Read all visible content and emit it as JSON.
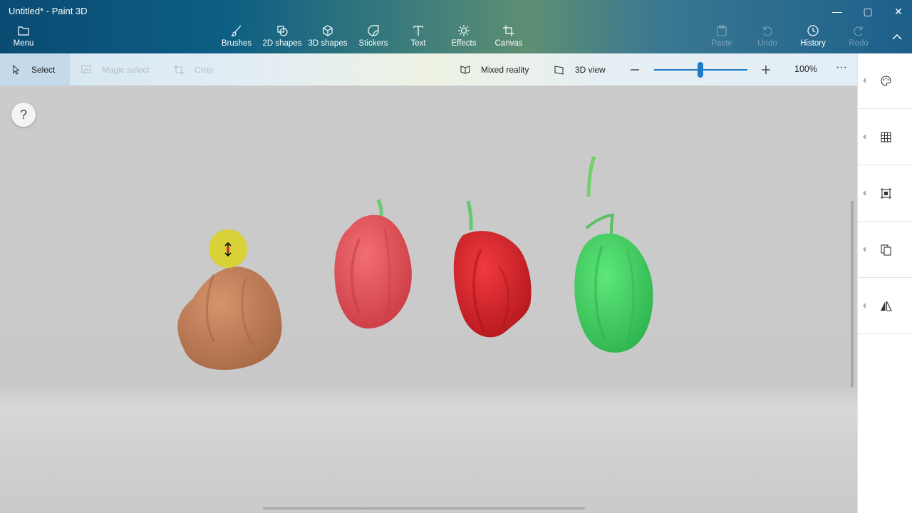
{
  "window": {
    "title": "Untitled* - Paint 3D",
    "minimize": "—",
    "maximize": "▢",
    "close": "✕"
  },
  "ribbon": {
    "menu": "Menu",
    "tools": [
      {
        "label": "Brushes",
        "icon": "brush-icon"
      },
      {
        "label": "2D shapes",
        "icon": "2d-shapes-icon"
      },
      {
        "label": "3D shapes",
        "icon": "3d-shapes-icon"
      },
      {
        "label": "Stickers",
        "icon": "stickers-icon"
      },
      {
        "label": "Text",
        "icon": "text-icon"
      },
      {
        "label": "Effects",
        "icon": "effects-icon"
      },
      {
        "label": "Canvas",
        "icon": "canvas-icon"
      }
    ],
    "actions": [
      {
        "label": "Paste",
        "enabled": false
      },
      {
        "label": "Undo",
        "enabled": false
      },
      {
        "label": "History",
        "enabled": true
      },
      {
        "label": "Redo",
        "enabled": false
      }
    ]
  },
  "toolbar": {
    "select": "Select",
    "magic_select": "Magic select",
    "crop": "Crop",
    "mixed_reality": "Mixed reality",
    "view_3d": "3D view",
    "zoom_minus": "—",
    "zoom_plus": "+",
    "zoom_level": "100%",
    "zoom_fraction": 0.5,
    "more": "···"
  },
  "canvas": {
    "help": "?",
    "objects": [
      {
        "name": "brown-pepper",
        "color": "#c98560"
      },
      {
        "name": "pink-pepper",
        "color": "#e8555c"
      },
      {
        "name": "red-pepper",
        "color": "#e22b30"
      },
      {
        "name": "green-pepper",
        "color": "#48d868"
      }
    ]
  },
  "side_panel": [
    {
      "icon": "palette-icon"
    },
    {
      "icon": "grid-icon"
    },
    {
      "icon": "crop-frame-icon"
    },
    {
      "icon": "copy-icon"
    },
    {
      "icon": "flip-icon"
    }
  ],
  "colors": {
    "accent": "#1f7ac8"
  }
}
